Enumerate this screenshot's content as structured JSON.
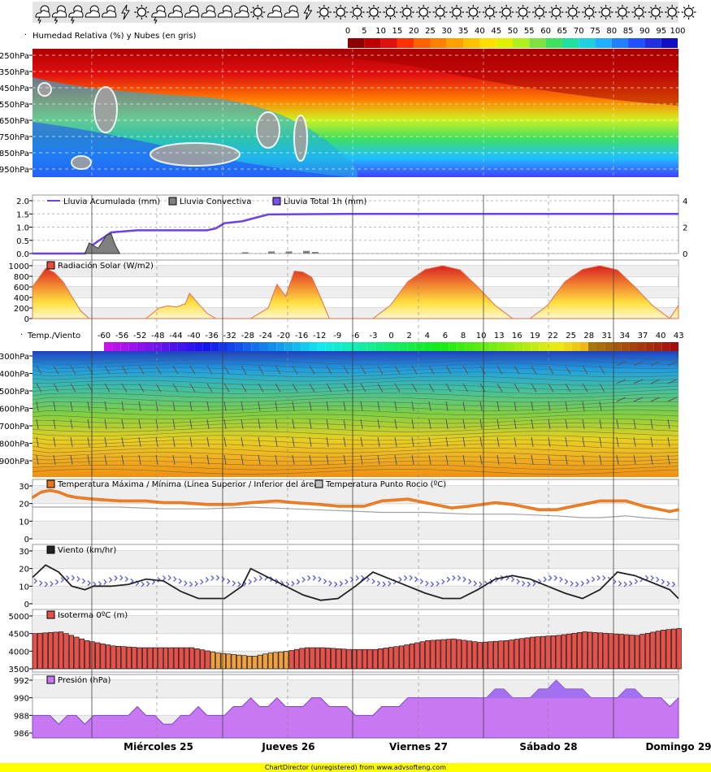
{
  "icons": [
    "storm-cloud-icon",
    "storm-cloud-icon",
    "storm-cloud-icon",
    "partly-cloudy-icon",
    "partly-cloudy-icon",
    "lightning-icon",
    "sun-icon",
    "storm-cloud-icon",
    "partly-cloudy-icon",
    "partly-cloudy-icon",
    "partly-cloudy-icon",
    "partly-cloudy-icon",
    "partly-cloudy-icon",
    "sun-icon",
    "partly-cloudy-icon",
    "partly-cloudy-icon",
    "lightning-icon",
    "sun-icon",
    "sun-icon",
    "sun-icon",
    "sun-icon",
    "sun-icon",
    "sun-icon",
    "sun-icon",
    "sun-icon",
    "sun-icon",
    "sun-icon",
    "sun-icon",
    "sun-icon",
    "sun-icon",
    "sun-icon",
    "sun-icon",
    "sun-icon",
    "sun-icon",
    "sun-icon",
    "sun-icon",
    "sun-icon",
    "sun-icon",
    "sun-icon",
    "sun-icon"
  ],
  "colors": {
    "rain_accum": "#6b42e6",
    "rain_conv": "#808080",
    "rain_total": "#7b52f0",
    "solar": "#e84a3c",
    "temp_line": "#e8761c",
    "dew": "#a0a0a0",
    "wind_line": "#222222",
    "wind_arrows": "#5b5bd6",
    "iso_bar": "#e8504a",
    "iso_bar_low": "#f0a040",
    "pressure": "#c878f0",
    "pressure_high": "#9a6ef0"
  },
  "chart_data": [
    {
      "type": "heatmap",
      "title": "Humedad Relativa (%) y Nubes (en gris)",
      "scale_labels": [
        "0",
        "5",
        "10",
        "15",
        "20",
        "25",
        "30",
        "35",
        "40",
        "45",
        "50",
        "55",
        "60",
        "65",
        "70",
        "75",
        "80",
        "85",
        "90",
        "95",
        "100"
      ],
      "y_ticks": [
        "250hPa",
        "350hPa",
        "450hPa",
        "550hPa",
        "650hPa",
        "750hPa",
        "850hPa",
        "950hPa"
      ]
    },
    {
      "type": "line",
      "legend": [
        "Lluvia Acumulada (mm)",
        "Lluvia Convectiva",
        "Lluvia Total 1h (mm)"
      ],
      "y_ticks": [
        "2.0",
        "1.5",
        "1.0",
        "0.5",
        "0.0"
      ],
      "y2_ticks": [
        "4",
        "2",
        "0"
      ],
      "ylim": [
        0,
        2.0
      ],
      "y2lim": [
        0,
        4
      ],
      "series": [
        {
          "name": "Lluvia Acumulada (mm)",
          "x": [
            0,
            8,
            12,
            14,
            18,
            24,
            30,
            33,
            36,
            40,
            42,
            44,
            48,
            54,
            72,
            96,
            120,
            144,
            148
          ],
          "values": [
            0,
            0,
            0,
            0.35,
            0.8,
            0.88,
            0.88,
            0.88,
            0.88,
            0.88,
            0.95,
            1.15,
            1.22,
            1.48,
            1.5,
            1.5,
            1.5,
            1.5,
            1.5
          ]
        },
        {
          "name": "Lluvia Convectiva",
          "x": [
            12,
            13,
            14,
            15,
            16,
            17,
            18,
            19,
            20
          ],
          "values": [
            0,
            0.4,
            0.3,
            0.2,
            0.45,
            0.7,
            0.75,
            0.3,
            0
          ]
        }
      ]
    },
    {
      "type": "area",
      "legend": [
        "Radiación Solar (W/m2)"
      ],
      "y_ticks": [
        "1000",
        "800",
        "600",
        "400",
        "200",
        "0"
      ],
      "ylim": [
        0,
        1000
      ],
      "series": [
        {
          "name": "Radiación Solar (W/m2)",
          "x": [
            0,
            3,
            5,
            7,
            9,
            11,
            13,
            26,
            29,
            31,
            33,
            35,
            36,
            38,
            40,
            42,
            50,
            54,
            56,
            58,
            60,
            62,
            64,
            66,
            68,
            78,
            82,
            86,
            90,
            94,
            98,
            102,
            106,
            110,
            114,
            118,
            122,
            126,
            130,
            134,
            138,
            142,
            146,
            148
          ],
          "values": [
            600,
            950,
            870,
            700,
            420,
            150,
            0,
            0,
            200,
            240,
            220,
            280,
            480,
            280,
            100,
            0,
            0,
            200,
            650,
            420,
            900,
            880,
            780,
            400,
            0,
            0,
            250,
            700,
            930,
            1000,
            920,
            600,
            250,
            0,
            0,
            250,
            700,
            930,
            1000,
            920,
            600,
            250,
            0,
            250
          ]
        }
      ]
    },
    {
      "type": "heatmap",
      "title": "Temp./Viento",
      "scale_labels": [
        "-60",
        "-56",
        "-52",
        "-48",
        "-44",
        "-40",
        "-36",
        "-32",
        "-28",
        "-24",
        "-20",
        "-16",
        "-12",
        "-9",
        "-6",
        "-3",
        "0",
        "2",
        "4",
        "6",
        "8",
        "10",
        "13",
        "16",
        "19",
        "22",
        "25",
        "28",
        "31",
        "34",
        "37",
        "40",
        "43"
      ],
      "y_ticks": [
        "300hPa",
        "400hPa",
        "500hPa",
        "600hPa",
        "700hPa",
        "800hPa",
        "900hPa"
      ]
    },
    {
      "type": "line",
      "legend": [
        "Temperatura Máxima / Mínima (Línea Superior / Inferior del área)",
        "Temperatura Punto Rocio (ºC)"
      ],
      "y_ticks": [
        "30",
        "20",
        "10",
        "0"
      ],
      "ylim": [
        0,
        30
      ],
      "series": [
        {
          "name": "Temperatura Máxima",
          "x": [
            0,
            2,
            4,
            6,
            8,
            10,
            14,
            20,
            26,
            30,
            34,
            40,
            46,
            50,
            56,
            60,
            66,
            70,
            76,
            80,
            86,
            90,
            96,
            100,
            106,
            110,
            116,
            120,
            126,
            130,
            136,
            140,
            146,
            148
          ],
          "values": [
            24,
            27,
            28,
            27,
            25,
            24,
            23,
            22,
            22,
            21,
            21,
            20,
            20,
            21,
            22,
            21,
            20,
            19,
            19,
            22,
            23,
            21,
            18,
            19,
            21,
            20,
            17,
            17,
            20,
            22,
            22,
            19,
            16,
            17
          ]
        },
        {
          "name": "Temperatura Mínima",
          "x": [
            0,
            2,
            4,
            6,
            8,
            10,
            14,
            20,
            26,
            30,
            34,
            40,
            46,
            50,
            56,
            60,
            66,
            70,
            76,
            80,
            86,
            90,
            96,
            100,
            106,
            110,
            116,
            120,
            126,
            130,
            136,
            140,
            146,
            148
          ],
          "values": [
            23,
            26,
            27,
            26,
            24,
            23,
            22,
            21,
            21,
            20,
            20,
            19,
            19,
            20,
            21,
            20,
            19,
            18,
            18,
            21,
            22,
            20,
            17,
            18,
            20,
            19,
            16,
            16,
            19,
            21,
            21,
            18,
            15,
            16
          ]
        },
        {
          "name": "Temperatura Punto Rocio (ºC)",
          "x": [
            0,
            10,
            20,
            30,
            40,
            50,
            60,
            70,
            80,
            90,
            100,
            110,
            120,
            126,
            130,
            136,
            140,
            146,
            148
          ],
          "values": [
            18,
            18,
            18,
            17,
            17,
            18,
            17,
            16,
            15,
            15,
            14,
            14,
            13,
            12,
            12,
            13,
            12,
            11,
            11
          ]
        }
      ]
    },
    {
      "type": "line",
      "legend": [
        "Viento (km/hr)"
      ],
      "y_ticks": [
        "30",
        "20",
        "10",
        "0"
      ],
      "ylim": [
        0,
        30
      ],
      "series": [
        {
          "name": "Viento (km/hr)",
          "x": [
            0,
            3,
            6,
            9,
            12,
            14,
            18,
            22,
            26,
            30,
            34,
            38,
            40,
            44,
            48,
            50,
            54,
            58,
            62,
            66,
            70,
            74,
            78,
            82,
            86,
            90,
            94,
            98,
            102,
            106,
            110,
            114,
            118,
            122,
            126,
            130,
            134,
            138,
            142,
            146,
            148
          ],
          "values": [
            15,
            22,
            18,
            10,
            8,
            10,
            10,
            11,
            14,
            13,
            7,
            3,
            3,
            3,
            10,
            20,
            15,
            10,
            5,
            2,
            3,
            10,
            18,
            14,
            10,
            6,
            3,
            3,
            8,
            14,
            16,
            14,
            10,
            6,
            3,
            8,
            18,
            16,
            12,
            8,
            3
          ]
        }
      ]
    },
    {
      "type": "bar",
      "legend": [
        "Isoterma 0ºC (m)"
      ],
      "y_ticks": [
        "5000",
        "4500",
        "4000",
        "3500"
      ],
      "ylim": [
        3500,
        5000
      ],
      "x": [
        0,
        6,
        12,
        18,
        24,
        30,
        36,
        42,
        46,
        50,
        54,
        58,
        62,
        66,
        72,
        78,
        84,
        90,
        96,
        102,
        108,
        114,
        120,
        126,
        132,
        138,
        144,
        148
      ],
      "values": [
        4500,
        4550,
        4300,
        4150,
        4100,
        4100,
        4100,
        3950,
        3900,
        3850,
        3950,
        4000,
        4100,
        4100,
        4050,
        4050,
        4150,
        4300,
        4350,
        4250,
        4300,
        4400,
        4450,
        4550,
        4500,
        4450,
        4600,
        4650
      ]
    },
    {
      "type": "area",
      "legend": [
        "Presión (hPa)"
      ],
      "y_ticks": [
        "992",
        "990",
        "988",
        "986"
      ],
      "ylim": [
        985.5,
        992.5
      ],
      "x": [
        0,
        4,
        6,
        8,
        10,
        12,
        14,
        16,
        18,
        20,
        22,
        24,
        26,
        28,
        30,
        32,
        34,
        36,
        38,
        40,
        42,
        44,
        46,
        48,
        50,
        52,
        54,
        56,
        58,
        60,
        62,
        64,
        66,
        68,
        70,
        72,
        74,
        76,
        78,
        80,
        82,
        84,
        86,
        88,
        90,
        92,
        94,
        96,
        98,
        100,
        102,
        104,
        106,
        108,
        110,
        112,
        114,
        116,
        118,
        120,
        122,
        124,
        126,
        128,
        130,
        132,
        134,
        136,
        138,
        140,
        142,
        144,
        146,
        148
      ],
      "values": [
        988,
        988,
        987,
        988,
        988,
        987,
        988,
        988,
        988,
        988,
        988,
        989,
        988,
        988,
        987,
        987,
        988,
        988,
        989,
        988,
        988,
        988,
        989,
        989,
        990,
        989,
        989,
        990,
        989,
        989,
        989,
        990,
        990,
        989,
        989,
        989,
        988,
        988,
        988,
        989,
        989,
        989,
        990,
        990,
        990,
        990,
        990,
        990,
        990,
        990,
        990,
        990,
        991,
        991,
        990,
        990,
        990,
        991,
        991,
        992,
        991,
        991,
        991,
        990,
        990,
        990,
        990,
        991,
        991,
        990,
        990,
        990,
        989,
        990
      ]
    }
  ],
  "days": [
    "Miércoles 25",
    "Jueves 26",
    "Viernes 27",
    "Sábado 28",
    "Domingo 29"
  ],
  "footer": "ChartDirector (unregistered) from www.advsofteng.com"
}
